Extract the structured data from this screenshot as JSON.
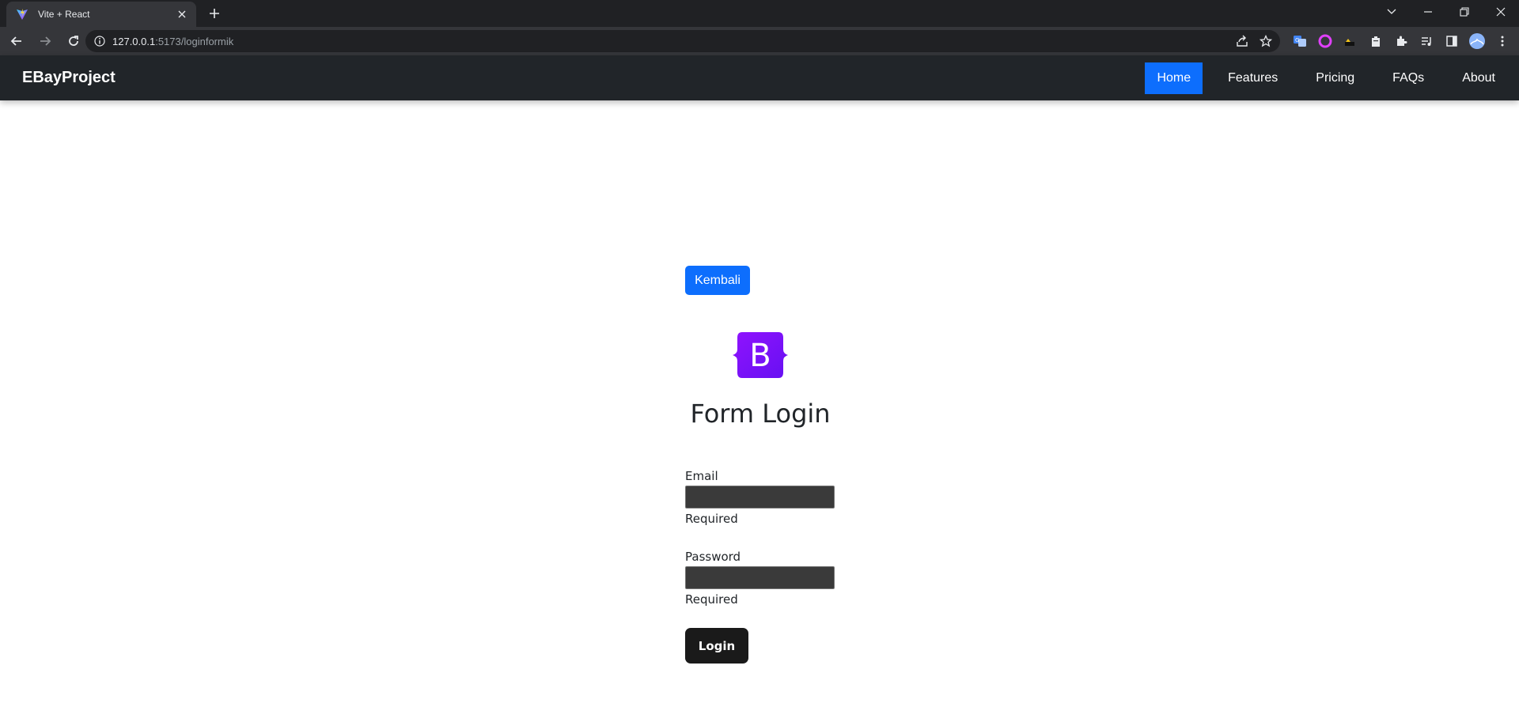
{
  "browser": {
    "tab_title": "Vite + React",
    "url_host": "127.0.0.1",
    "url_path": ":5173/loginformik"
  },
  "navbar": {
    "brand": "EBayProject",
    "links": [
      {
        "label": "Home",
        "active": true
      },
      {
        "label": "Features",
        "active": false
      },
      {
        "label": "Pricing",
        "active": false
      },
      {
        "label": "FAQs",
        "active": false
      },
      {
        "label": "About",
        "active": false
      }
    ]
  },
  "page": {
    "back_button": "Kembali",
    "logo_letter": "B",
    "title": "Form Login",
    "email_label": "Email",
    "email_value": "",
    "email_error": "Required",
    "password_label": "Password",
    "password_value": "",
    "password_error": "Required",
    "login_button": "Login"
  },
  "colors": {
    "primary": "#0d6efd",
    "navbar_bg": "#212529",
    "logo_purple": "#7a13f0",
    "login_bg": "#1a1a1a"
  }
}
